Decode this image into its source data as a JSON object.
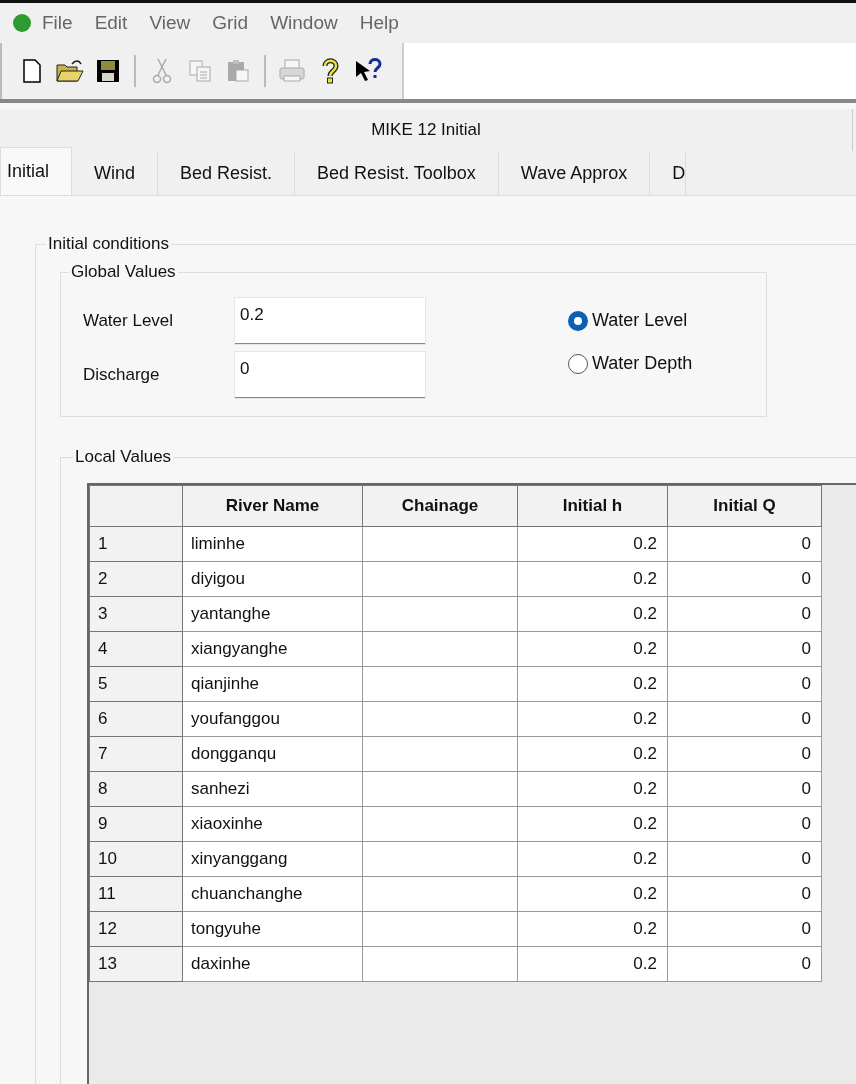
{
  "menu": [
    "File",
    "Edit",
    "View",
    "Grid",
    "Window",
    "Help"
  ],
  "toolbar": [
    {
      "kind": "new",
      "disabled": false
    },
    {
      "kind": "open",
      "disabled": false
    },
    {
      "kind": "save",
      "disabled": false
    },
    {
      "kind": "separator"
    },
    {
      "kind": "cut",
      "disabled": true
    },
    {
      "kind": "copy",
      "disabled": true
    },
    {
      "kind": "paste",
      "disabled": true
    },
    {
      "kind": "separator"
    },
    {
      "kind": "print",
      "disabled": true
    },
    {
      "kind": "help",
      "disabled": false
    },
    {
      "kind": "context-help",
      "disabled": false
    }
  ],
  "window": {
    "title": "MIKE 12 Initial"
  },
  "tabs": [
    {
      "label": "Initial",
      "selected": true
    },
    {
      "label": "Wind",
      "selected": false
    },
    {
      "label": "Bed Resist.",
      "selected": false
    },
    {
      "label": "Bed Resist. Toolbox",
      "selected": false
    },
    {
      "label": "Wave Approx",
      "selected": false
    },
    {
      "label": "D",
      "selected": false
    }
  ],
  "initial_conditions": {
    "title": "Initial conditions",
    "global_values": {
      "title": "Global Values",
      "fields": [
        {
          "label": "Water Level",
          "value": "0.2"
        },
        {
          "label": "Discharge",
          "value": "0"
        }
      ],
      "options": [
        {
          "label": "Water Level",
          "selected": true
        },
        {
          "label": "Water Depth",
          "selected": false
        }
      ]
    },
    "local_values": {
      "title": "Local Values",
      "table": {
        "columns": [
          "",
          "River Name",
          "Chainage",
          "Initial h",
          "Initial Q"
        ],
        "rows": [
          [
            "1",
            "liminhe",
            "",
            "0.2",
            "0"
          ],
          [
            "2",
            "diyigou",
            "",
            "0.2",
            "0"
          ],
          [
            "3",
            "yantanghe",
            "",
            "0.2",
            "0"
          ],
          [
            "4",
            "xiangyanghe",
            "",
            "0.2",
            "0"
          ],
          [
            "5",
            "qianjinhe",
            "",
            "0.2",
            "0"
          ],
          [
            "6",
            "youfanggou",
            "",
            "0.2",
            "0"
          ],
          [
            "7",
            "dongganqu",
            "",
            "0.2",
            "0"
          ],
          [
            "8",
            "sanhezi",
            "",
            "0.2",
            "0"
          ],
          [
            "9",
            "xiaoxinhe",
            "",
            "0.2",
            "0"
          ],
          [
            "10",
            "xinyanggang",
            "",
            "0.2",
            "0"
          ],
          [
            "11",
            "chuanchanghe",
            "",
            "0.2",
            "0"
          ],
          [
            "12",
            "tongyuhe",
            "",
            "0.2",
            "0"
          ],
          [
            "13",
            "daxinhe",
            "",
            "0.2",
            "0"
          ]
        ]
      }
    }
  }
}
